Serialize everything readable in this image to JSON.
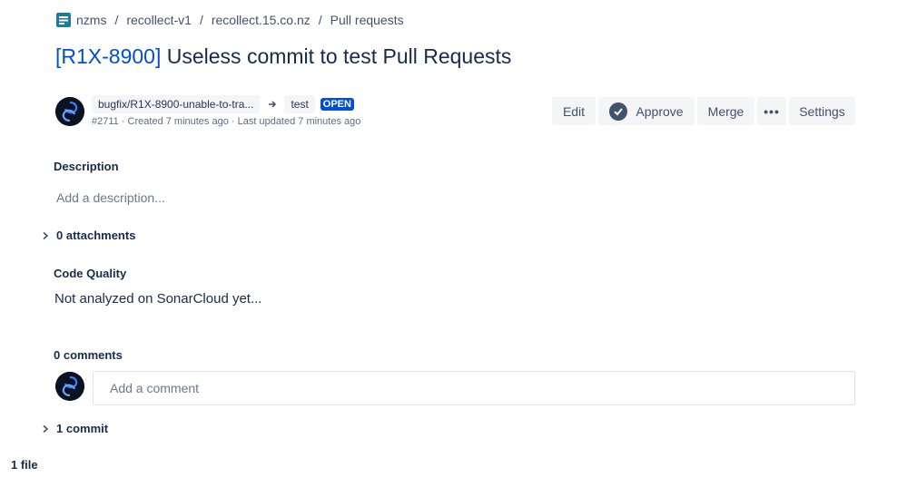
{
  "breadcrumb": {
    "items": [
      "nzms",
      "recollect-v1",
      "recollect.15.co.nz",
      "Pull requests"
    ],
    "separator": "/"
  },
  "pull_request": {
    "key": "R1X-8900",
    "key_display": "[R1X-8900]",
    "title": "Useless commit to test Pull Requests",
    "source_branch": "bugfix/R1X-8900-unable-to-tra...",
    "target_branch": "test",
    "state": "OPEN",
    "meta": "#2711 · Created 7 minutes ago · Last updated 7 minutes ago"
  },
  "actions": {
    "edit": "Edit",
    "approve": "Approve",
    "merge": "Merge",
    "more": "•••",
    "settings": "Settings"
  },
  "description": {
    "heading": "Description",
    "placeholder": "Add a description..."
  },
  "attachments": {
    "label": "0 attachments"
  },
  "code_quality": {
    "heading": "Code Quality",
    "status": "Not analyzed on SonarCloud yet..."
  },
  "comments": {
    "heading": "0 comments",
    "input_placeholder": "Add a comment"
  },
  "commits": {
    "label": "1 commit"
  },
  "files": {
    "label": "1 file"
  },
  "icons": {
    "repo": "repo-icon",
    "avatar": "avatar",
    "branch_arrow": "arrow-right-icon",
    "approve": "check-circle-icon",
    "expand": "chevron-right-icon"
  },
  "colors": {
    "link": "#0052cc",
    "text": "#172b4d",
    "subtle": "#42526e",
    "button_bg": "#f4f5f7",
    "lozenge_bg": "#0052cc"
  }
}
